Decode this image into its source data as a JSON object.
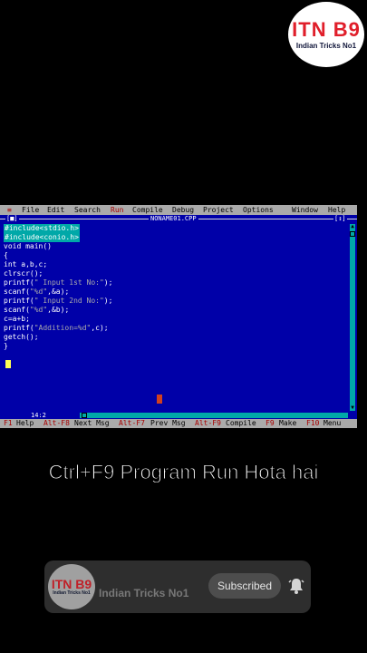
{
  "channel": {
    "logo_text": "ITN B9",
    "logo_subtitle": "Indian Tricks No1",
    "name": "Indian Tricks No1",
    "subscribe_label": "Subscribed"
  },
  "ide": {
    "window_menu_icon": "≡",
    "menu": [
      "File",
      "Edit",
      "Search",
      "Run",
      "Compile",
      "Debug",
      "Project",
      "Options",
      "Window",
      "Help"
    ],
    "title": {
      "close": "[■]",
      "filename": "NONAME01.CPP",
      "zoom": "[↕]"
    },
    "code": [
      "#include<stdio.h>",
      "#include<conio.h>",
      "void main()",
      "{",
      "int a,b,c;",
      "clrscr();",
      "printf(\" Input 1st No:\");",
      "scanf(\"%d\",&a);",
      "printf(\" Input 2nd No:\");",
      "scanf(\"%d\",&b);",
      "c=a+b;",
      "printf(\"Addition=%d\",c);",
      "getch();",
      "}"
    ],
    "cursor_pos": "14:2",
    "function_keys": [
      {
        "key": "F1",
        "label": "Help"
      },
      {
        "key": "Alt-F8",
        "label": "Next Msg"
      },
      {
        "key": "Alt-F7",
        "label": "Prev Msg"
      },
      {
        "key": "Alt-F9",
        "label": "Compile"
      },
      {
        "key": "F9",
        "label": "Make"
      },
      {
        "key": "F10",
        "label": "Menu"
      }
    ]
  },
  "caption": "Ctrl+F9 Program Run Hota hai"
}
